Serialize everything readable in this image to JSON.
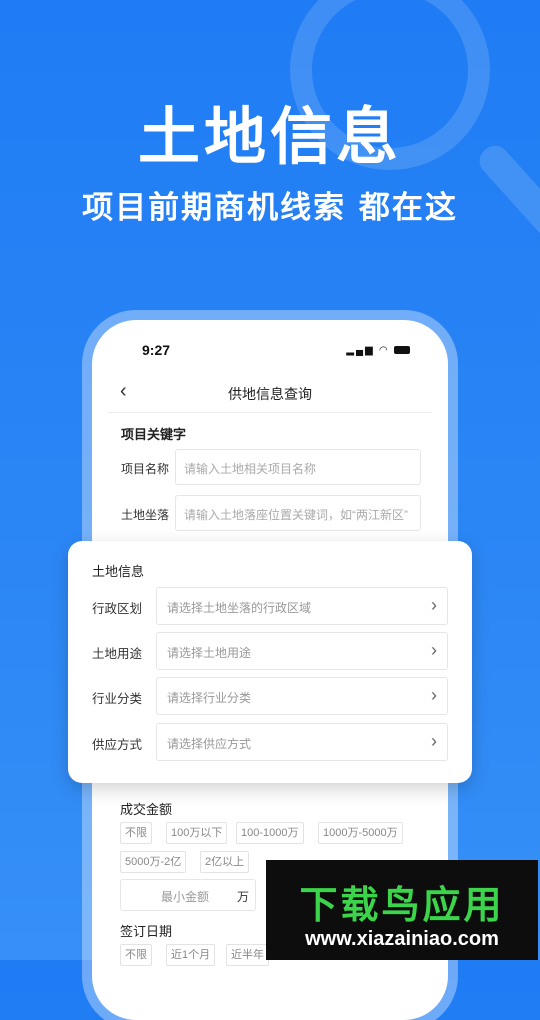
{
  "hero": {
    "title": "土地信息",
    "subtitle": "项目前期商机线索 都在这"
  },
  "phone": {
    "status_time": "9:27",
    "nav_back_icon": "chevron-left-icon",
    "nav_title": "供地信息查询",
    "keyword_section": "项目关键字",
    "fields": [
      {
        "label": "项目名称",
        "placeholder": "请输入土地相关项目名称"
      },
      {
        "label": "土地坐落",
        "placeholder": "请输入土地落座位置关键词，如“两江新区”"
      }
    ]
  },
  "card": {
    "title": "土地信息",
    "rows": [
      {
        "label": "行政区划",
        "placeholder": "请选择土地坐落的行政区域"
      },
      {
        "label": "土地用途",
        "placeholder": "请选择土地用途"
      },
      {
        "label": "行业分类",
        "placeholder": "请选择行业分类"
      },
      {
        "label": "供应方式",
        "placeholder": "请选择供应方式"
      }
    ]
  },
  "amount": {
    "title": "成交金额",
    "chips": [
      "不限",
      "100万以下",
      "100-1000万",
      "1000万-5000万",
      "5000万-2亿",
      "2亿以上"
    ],
    "min_placeholder": "最小金额",
    "unit": "万"
  },
  "date": {
    "title": "签订日期",
    "chips": [
      "不限",
      "近1个月",
      "近半年"
    ]
  },
  "watermark": {
    "title": "下载鸟应用",
    "url": "www.xiazainiao.com"
  },
  "colors": {
    "bg": "#1f7cf4",
    "watermark_green": "#3bd44a"
  }
}
